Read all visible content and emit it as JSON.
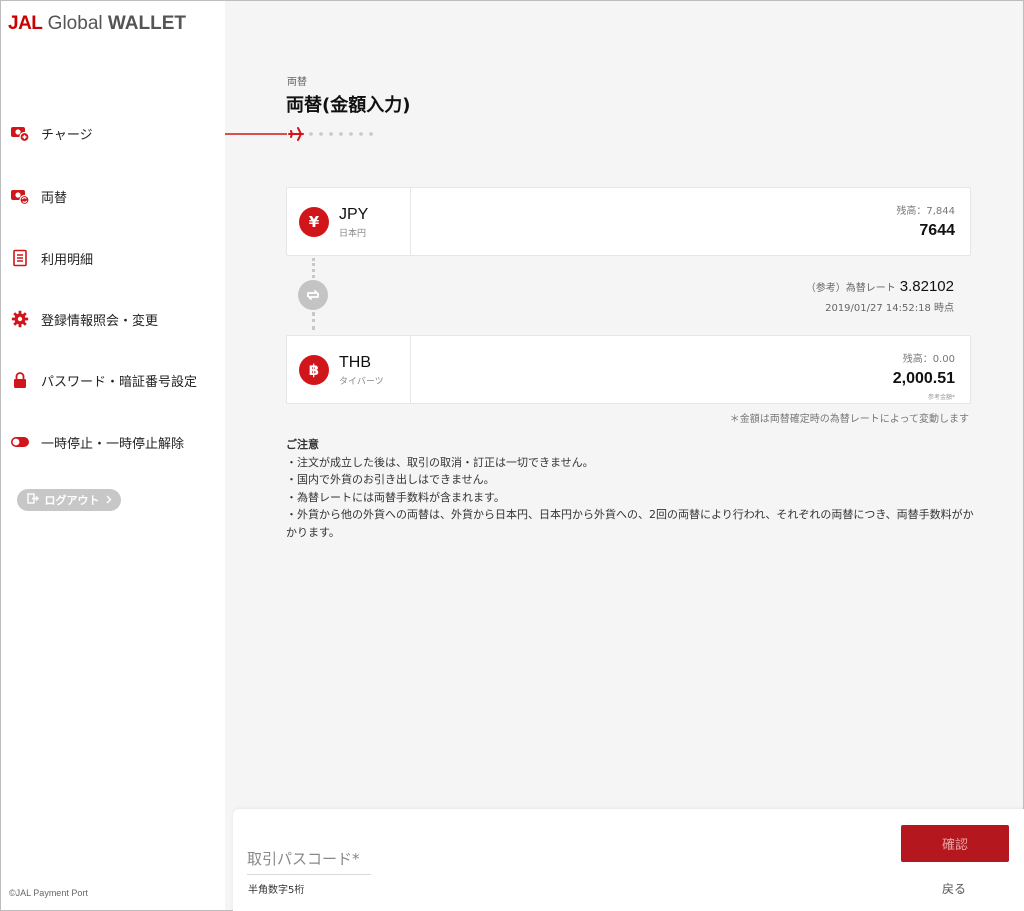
{
  "app": {
    "logo_brand": "JAL",
    "logo_mid": " Global ",
    "logo_end": "WALLET",
    "copyright": "©JAL Payment Port"
  },
  "colors": {
    "brand_red": "#d0161b",
    "confirm_button": "#b5171f",
    "sidebar_bg": "#ffffff",
    "main_bg": "#f5f5f5"
  },
  "sidebar": {
    "items": [
      {
        "label": "チャージ",
        "icon": "wallet-charge-icon"
      },
      {
        "label": "両替",
        "icon": "wallet-exchange-icon"
      },
      {
        "label": "利用明細",
        "icon": "list-document-icon"
      },
      {
        "label": "登録情報照会・変更",
        "icon": "gear-icon"
      },
      {
        "label": "パスワード・暗証番号設定",
        "icon": "lock-icon"
      },
      {
        "label": "一時停止・一時停止解除",
        "icon": "toggle-icon"
      }
    ],
    "logout_label": "ログアウト"
  },
  "header": {
    "breadcrumb": "両替",
    "title": "両替(金額入力)"
  },
  "progress": {
    "current_step": 1,
    "total_steps": 7
  },
  "from_currency": {
    "symbol": "¥",
    "code": "JPY",
    "name": "日本円",
    "balance_label": "残高：7,844",
    "amount": "7644"
  },
  "rate": {
    "prefix": "（参考）為替レート",
    "value": "3.82102",
    "timestamp": "2019/01/27 14:52:18 時点"
  },
  "to_currency": {
    "symbol": "฿",
    "code": "THB",
    "name": "タイバーツ",
    "balance_label": "残高：0.00",
    "amount": "2,000.51",
    "amount_caption": "参考金額*"
  },
  "amount_note": "＊金額は両替確定時の為替レートによって変動します",
  "notes": {
    "title": "ご注意",
    "items": [
      "・注文が成立した後は、取引の取消・訂正は一切できません。",
      "・国内で外貨のお引き出しはできません。",
      "・為替レートには両替手数料が含まれます。",
      "・外貨から他の外貨への両替は、外貨から日本円、日本円から外貨への、2回の両替により行われ、それぞれの両替につき、両替手数料がかかります。"
    ]
  },
  "form": {
    "passcode_placeholder": "取引パスコード*",
    "passcode_value": "",
    "passcode_hint": "半角数字5桁",
    "confirm_label": "確認",
    "back_label": "戻る"
  }
}
